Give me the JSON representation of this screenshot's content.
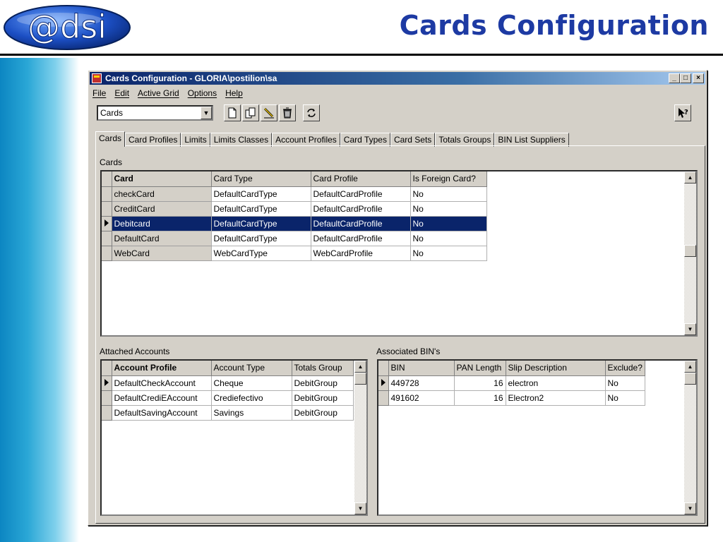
{
  "slide": {
    "logo_text": "@dsi",
    "title": "Cards  Configuration"
  },
  "window": {
    "title": "Cards Configuration - GLORIA\\postilion\\sa",
    "controls": {
      "minimize": "_",
      "maximize": "□",
      "close": "×"
    }
  },
  "menu": [
    "File",
    "Edit",
    "Active Grid",
    "Options",
    "Help"
  ],
  "toolbar": {
    "selector_value": "Cards",
    "icons": [
      "new-icon",
      "copy-icon",
      "edit-icon",
      "delete-icon",
      "refresh-icon",
      "help-pointer-icon"
    ]
  },
  "tabs": [
    "Cards",
    "Card Profiles",
    "Limits",
    "Limits Classes",
    "Account Profiles",
    "Card Types",
    "Card Sets",
    "Totals Groups",
    "BIN List Suppliers"
  ],
  "cards": {
    "label": "Cards",
    "columns": [
      "Card",
      "Card Type",
      "Card Profile",
      "Is Foreign Card?"
    ],
    "rows": [
      [
        "checkCard",
        "DefaultCardType",
        "DefaultCardProfile",
        "No"
      ],
      [
        "CreditCard",
        "DefaultCardType",
        "DefaultCardProfile",
        "No"
      ],
      [
        "Debitcard",
        "DefaultCardType",
        "DefaultCardProfile",
        "No"
      ],
      [
        "DefaultCard",
        "DefaultCardType",
        "DefaultCardProfile",
        "No"
      ],
      [
        "WebCard",
        "WebCardType",
        "WebCardProfile",
        "No"
      ]
    ],
    "selected_row": 2
  },
  "accounts": {
    "label": "Attached Accounts",
    "columns": [
      "Account Profile",
      "Account Type",
      "Totals Group"
    ],
    "rows": [
      [
        "DefaultCheckAccount",
        "Cheque",
        "DebitGroup"
      ],
      [
        "DefaultCrediEAccount",
        "Crediefectivo",
        "DebitGroup"
      ],
      [
        "DefaultSavingAccount",
        "Savings",
        "DebitGroup"
      ]
    ]
  },
  "bins": {
    "label": "Associated BIN's",
    "columns": [
      "BIN",
      "PAN Length",
      "Slip Description",
      "Exclude?"
    ],
    "rows": [
      [
        "449728",
        "16",
        "electron",
        "No"
      ],
      [
        "491602",
        "16",
        "Electron2",
        "No"
      ]
    ]
  },
  "colors": {
    "title_blue": "#1d3aa3",
    "selection": "#0a246a",
    "window_gray": "#d4d0c8"
  }
}
